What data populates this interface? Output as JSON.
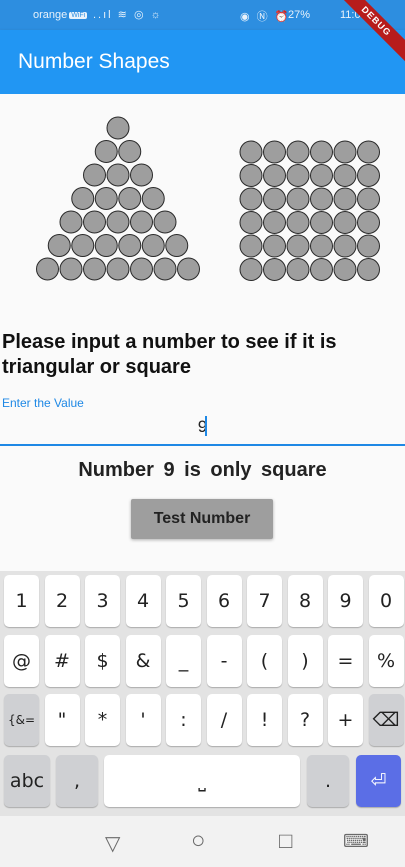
{
  "status_bar": {
    "carrier": "orange",
    "carrier_badge": "WiFi",
    "left_icons": "..ıl ≋ ◎ ☼",
    "right_icons": "◉ Ⓝ ⏰",
    "battery": "27%",
    "time": "11:0"
  },
  "app_bar": {
    "title": "Number Shapes"
  },
  "debug_banner": "DEBUG",
  "shapes": {
    "triangle_rows": 7,
    "square_side": 6,
    "dot_color": "#9e9e9e",
    "dot_stroke": "#2a2a2a"
  },
  "prompt": "Please input a number to see if it is triangular or square",
  "input": {
    "label": "Enter the Value",
    "value": "9"
  },
  "result": "Number  9  is  only  square",
  "test_button": "Test Number",
  "keyboard": {
    "row1": [
      "1",
      "2",
      "3",
      "4",
      "5",
      "6",
      "7",
      "8",
      "9",
      "0"
    ],
    "row2": [
      "@",
      "#",
      "$",
      "&",
      "_",
      "-",
      "(",
      ")",
      "=",
      "%"
    ],
    "row3": [
      "{&=",
      "\"",
      "*",
      "'",
      ":",
      "/",
      "!",
      "?",
      "+",
      "⌫"
    ],
    "row4": [
      "abc",
      ",",
      "⎵",
      ".",
      "⏎"
    ]
  },
  "nav_bar": {
    "back": "▽",
    "home": "○",
    "recents": "□",
    "keyboard": "⌨"
  }
}
